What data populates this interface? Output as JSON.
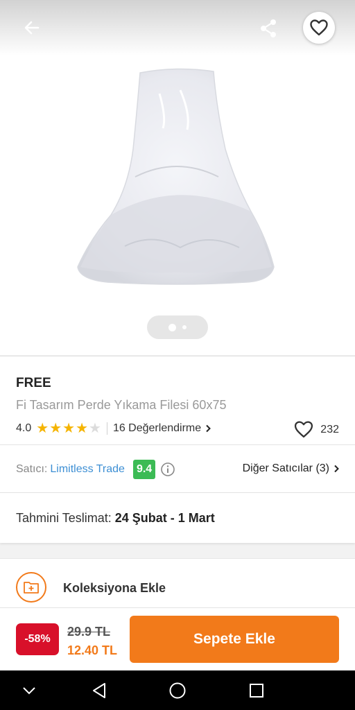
{
  "header": {
    "back_icon": "arrow-left-icon",
    "share_icon": "share-icon",
    "favorite_icon": "heart-outline-icon"
  },
  "gallery": {
    "image": "white mesh laundry bag",
    "page_count": 2,
    "current_page": 1
  },
  "product": {
    "brand": "FREE",
    "title": "Fi Tasarım Perde Yıkama Filesi 60x75",
    "rating": "4.0",
    "rating_value": 4,
    "reviews_label": "16 Değerlendirme",
    "likes": "232"
  },
  "seller": {
    "label": "Satıcı:",
    "name": "Limitless Trade",
    "score": "9.4",
    "other_sellers": "Diğer Satıcılar (3)"
  },
  "delivery": {
    "label": "Tahmini Teslimat:",
    "dates": "24 Şubat - 1 Mart"
  },
  "collection": {
    "label": "Koleksiyona Ekle"
  },
  "bottom": {
    "discount": "-58%",
    "old_price": "29.9 TL",
    "new_price": "12.40 TL",
    "cart_label": "Sepete Ekle"
  },
  "colors": {
    "accent": "#f27a1a",
    "discount": "#d8102a",
    "seller_link": "#3d8fd4",
    "score": "#3cbb55",
    "star": "#f5b400"
  },
  "navbar": {
    "items": [
      "chevron-down-icon",
      "back-triangle-icon",
      "home-circle-icon",
      "recents-square-icon"
    ]
  }
}
